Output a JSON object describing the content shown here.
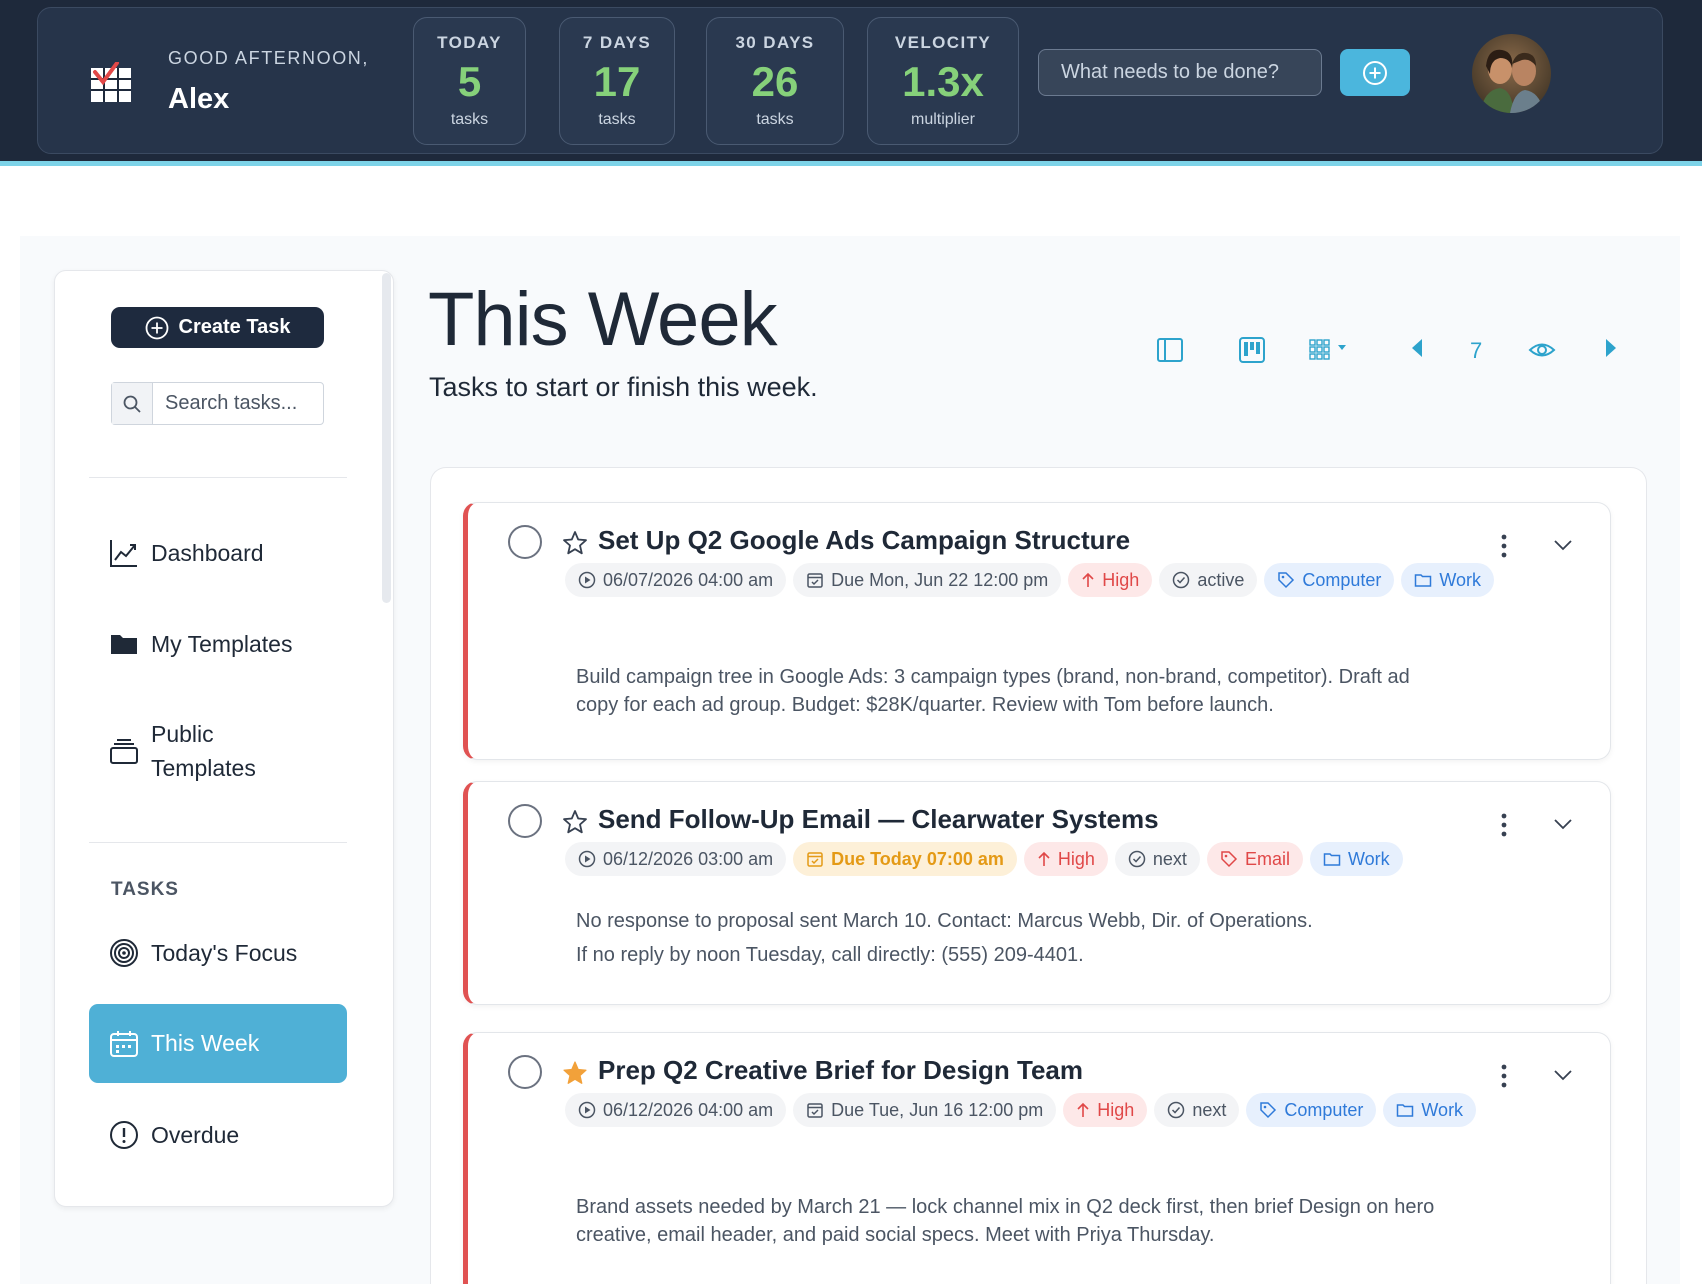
{
  "header": {
    "greeting_label": "GOOD AFTERNOON,",
    "user_name": "Alex",
    "stats": [
      {
        "label": "TODAY",
        "value": "5",
        "unit": "tasks"
      },
      {
        "label": "7 DAYS",
        "value": "17",
        "unit": "tasks"
      },
      {
        "label": "30 DAYS",
        "value": "26",
        "unit": "tasks"
      },
      {
        "label": "VELOCITY",
        "value": "1.3x",
        "unit": "multiplier"
      }
    ],
    "quick_add_placeholder": "What needs to be done?",
    "stat_value_color": "#86d17a"
  },
  "sidebar": {
    "create_label": "Create Task",
    "search_placeholder": "Search tasks...",
    "nav": [
      {
        "label": "Dashboard",
        "icon": "chart-line-icon"
      },
      {
        "label": "My Templates",
        "icon": "folder-icon"
      },
      {
        "label": "Public Templates",
        "icon": "layers-icon"
      }
    ],
    "section_label": "TASKS",
    "tasks_nav": [
      {
        "label": "Today's Focus",
        "icon": "target-icon"
      },
      {
        "label": "This Week",
        "icon": "calendar-icon",
        "active": true
      },
      {
        "label": "Overdue",
        "icon": "alert-circle-icon"
      }
    ],
    "active_color": "#4fb0d6"
  },
  "main": {
    "title": "This Week",
    "subtitle": "Tasks to start or finish this week.",
    "week_count": "7"
  },
  "tasks": [
    {
      "title": "Set Up Q2 Google Ads Campaign Structure",
      "starred": false,
      "start": "06/07/2026 04:00 am",
      "due": "Due Mon, Jun 22 12:00 pm",
      "priority": "High",
      "status": "active",
      "context": "Computer",
      "project": "Work",
      "description": "Build campaign tree in Google Ads: 3 campaign types (brand, non-brand, competitor). Draft ad copy for each ad group. Budget: $28K/quarter. Review with Tom before launch."
    },
    {
      "title": "Send Follow-Up Email — Clearwater Systems",
      "starred": false,
      "start": "06/12/2026 03:00 am",
      "due": "Due Today 07:00 am",
      "priority": "High",
      "status": "next",
      "context": "Email",
      "project": "Work",
      "description_line1": "No response to proposal sent March 10. Contact: Marcus Webb, Dir. of Operations.",
      "description_line2": "If no reply by noon Tuesday, call directly: (555) 209-4401."
    },
    {
      "title": "Prep Q2 Creative Brief for Design Team",
      "starred": true,
      "start": "06/12/2026 04:00 am",
      "due": "Due Tue, Jun 16 12:00 pm",
      "priority": "High",
      "status": "next",
      "context": "Computer",
      "project": "Work",
      "description": "Brand assets needed by March 21 — lock channel mix in Q2 deck first, then brief Design on hero creative, email header, and paid social specs. Meet with Priya Thursday."
    }
  ],
  "colors": {
    "priority_border": "#e05252",
    "accent": "#4bb6dd",
    "header_bg": "#1e293b"
  }
}
